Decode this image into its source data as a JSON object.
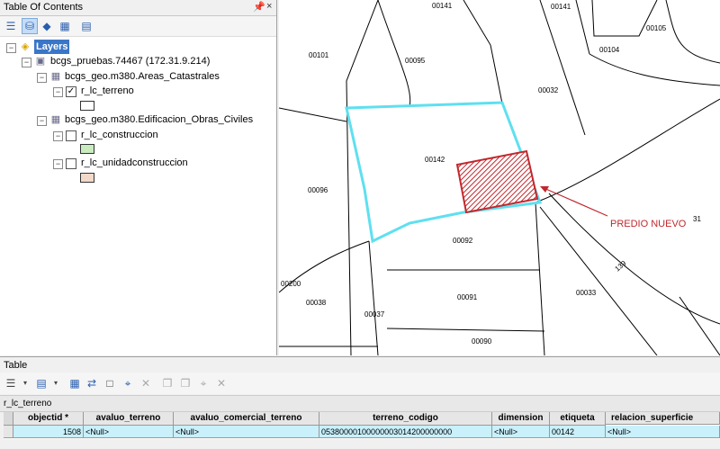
{
  "toc": {
    "title": "Table Of Contents",
    "pin_glyph": " ▫",
    "close_glyph": "×",
    "tree": {
      "root_label": "Layers",
      "server_label": "bcgs_pruebas.74467 (172.31.9.214)",
      "group1_label": "bcgs_geo.m380.Areas_Catastrales",
      "layer1_label": "r_lc_terreno",
      "group2_label": "bcgs_geo.m380.Edificacion_Obras_Civiles",
      "layer2_label": "r_lc_construccion",
      "layer3_label": "r_lc_unidadconstruccion"
    },
    "colors": {
      "swatch_terreno": "#ffffff",
      "swatch_construccion": "#c8ecc0",
      "swatch_unidad": "#f2d9c9"
    }
  },
  "map": {
    "parcel_labels": [
      "00141",
      "00141",
      "00105",
      "00101",
      "00095",
      "00104",
      "00032",
      "00142",
      "00096",
      "00092",
      "00200",
      "00038",
      "00037",
      "00091",
      "00033",
      "00090",
      "139",
      "31"
    ],
    "annotation_text": "PREDIO NUEVO",
    "colors": {
      "highlight": "#5ee0f0",
      "new_parcel": "#c0282d",
      "arrow": "#c0282d"
    }
  },
  "table": {
    "title": "Table",
    "layer_name": "r_lc_terreno",
    "columns": [
      "objectid *",
      "avaluo_terreno",
      "avaluo_comercial_terreno",
      "terreno_codigo",
      "dimension",
      "etiqueta",
      "relacion_superficie"
    ],
    "row": [
      "1508",
      "<Null>",
      "<Null>",
      "05380000100000003014200000000",
      "<Null>",
      "00142",
      "<Null>"
    ]
  }
}
